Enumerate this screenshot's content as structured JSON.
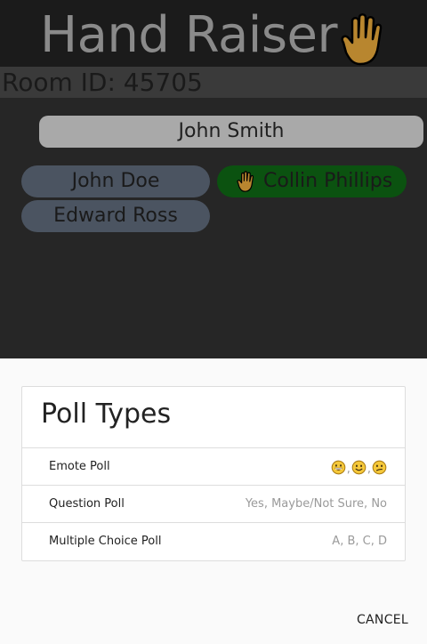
{
  "app": {
    "title": "Hand Raiser",
    "room_id_label": "Room ID: 45705"
  },
  "participants": {
    "current_user": "John Smith",
    "list": [
      {
        "name": "John Doe",
        "hand_raised": false
      },
      {
        "name": "Collin Phillips",
        "hand_raised": true
      },
      {
        "name": "Edward Ross",
        "hand_raised": false
      }
    ]
  },
  "dialog": {
    "title": "Poll Types",
    "options": [
      {
        "label": "Emote Poll",
        "hint_icons": [
          "grinning-face-icon",
          "slightly-smiling-face-icon",
          "confused-face-icon"
        ],
        "hint_separator": ","
      },
      {
        "label": "Question Poll",
        "hint": "Yes, Maybe/Not Sure, No"
      },
      {
        "label": "Multiple Choice Poll",
        "hint": "A, B, C, D"
      }
    ],
    "cancel_label": "CANCEL"
  },
  "colors": {
    "app_background": "#262626",
    "title_bar": "#1b1b1b",
    "room_bar": "#3a3a3a",
    "idle_pill": "#4b5461",
    "raised_pill": "#0b5210",
    "current_user_bar": "#a9a9a9",
    "hand_emoji": "#b8862f",
    "sheet_background": "#fafafa"
  }
}
